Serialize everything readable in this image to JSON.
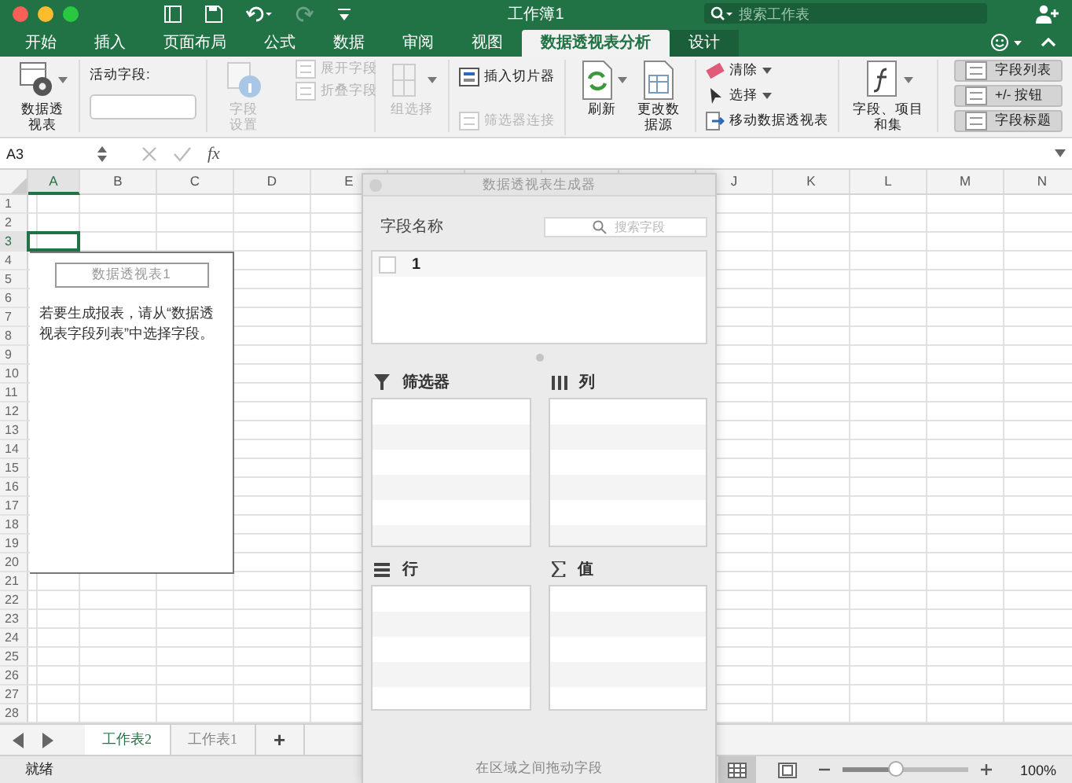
{
  "window": {
    "title": "工作簿1",
    "search_placeholder": "搜索工作表"
  },
  "tabs": [
    {
      "label": "开始",
      "selected": false,
      "contextual": false
    },
    {
      "label": "插入",
      "selected": false,
      "contextual": false
    },
    {
      "label": "页面布局",
      "selected": false,
      "contextual": false
    },
    {
      "label": "公式",
      "selected": false,
      "contextual": false
    },
    {
      "label": "数据",
      "selected": false,
      "contextual": false
    },
    {
      "label": "审阅",
      "selected": false,
      "contextual": false
    },
    {
      "label": "视图",
      "selected": false,
      "contextual": false
    },
    {
      "label": "数据透视表分析",
      "selected": true,
      "contextual": true
    },
    {
      "label": "设计",
      "selected": false,
      "contextual": true
    }
  ],
  "ribbon_groups": [
    {
      "items": [
        {
          "kind": "large",
          "label": "数据透视表",
          "disabled": false,
          "dropdown": true
        }
      ]
    },
    {
      "items": [
        {
          "kind": "field",
          "label": "活动字段:"
        }
      ]
    },
    {
      "items": [
        {
          "kind": "large",
          "label": "字段设置",
          "disabled": true,
          "dropdown": false
        },
        {
          "kind": "small",
          "label": "展开字段",
          "disabled": true,
          "dropdown": false
        },
        {
          "kind": "small",
          "label": "折叠字段",
          "disabled": true,
          "dropdown": false
        }
      ]
    },
    {
      "items": [
        {
          "kind": "large",
          "label": "组选择",
          "disabled": true,
          "dropdown": true
        }
      ]
    },
    {
      "items": [
        {
          "kind": "small",
          "label": "插入切片器",
          "disabled": false,
          "dropdown": false
        },
        {
          "kind": "small",
          "label": "筛选器连接",
          "disabled": true,
          "dropdown": false
        }
      ]
    },
    {
      "items": [
        {
          "kind": "large",
          "label": "刷新",
          "disabled": false,
          "dropdown": true
        },
        {
          "kind": "large",
          "label": "更改数据源",
          "disabled": false,
          "dropdown": false
        }
      ]
    },
    {
      "items": [
        {
          "kind": "small",
          "label": "清除",
          "disabled": false,
          "dropdown": true
        },
        {
          "kind": "small",
          "label": "选择",
          "disabled": false,
          "dropdown": true
        },
        {
          "kind": "small",
          "label": "移动数据透视表",
          "disabled": false,
          "dropdown": false
        }
      ]
    },
    {
      "items": [
        {
          "kind": "large",
          "label": "字段、项目和集",
          "disabled": false,
          "dropdown": true
        }
      ]
    },
    {
      "items": [
        {
          "kind": "toggle",
          "label": "字段列表",
          "selected": true
        },
        {
          "kind": "toggle",
          "label": "+/- 按钮",
          "selected": true
        },
        {
          "kind": "toggle",
          "label": "字段标题",
          "selected": true
        }
      ]
    }
  ],
  "formula_bar": {
    "name_box": "A3",
    "fx": "fx"
  },
  "sheet": {
    "columns_left": [
      {
        "label": "A",
        "selected": true
      },
      {
        "label": "B",
        "selected": false
      },
      {
        "label": "C",
        "selected": false
      },
      {
        "label": "D",
        "selected": false
      },
      {
        "label": "E",
        "selected": false
      }
    ],
    "columns_right": [
      {
        "label": "J",
        "selected": false
      },
      {
        "label": "K",
        "selected": false
      },
      {
        "label": "L",
        "selected": false
      },
      {
        "label": "M",
        "selected": false
      },
      {
        "label": "N",
        "selected": false
      }
    ],
    "rows": [
      {
        "label": "1",
        "selected": false
      },
      {
        "label": "2",
        "selected": false
      },
      {
        "label": "3",
        "selected": true
      },
      {
        "label": "4",
        "selected": false
      },
      {
        "label": "5",
        "selected": false
      },
      {
        "label": "6",
        "selected": false
      },
      {
        "label": "7",
        "selected": false
      },
      {
        "label": "8",
        "selected": false
      },
      {
        "label": "9",
        "selected": false
      },
      {
        "label": "10",
        "selected": false
      },
      {
        "label": "11",
        "selected": false
      },
      {
        "label": "12",
        "selected": false
      },
      {
        "label": "13",
        "selected": false
      },
      {
        "label": "14",
        "selected": false
      },
      {
        "label": "15",
        "selected": false
      },
      {
        "label": "16",
        "selected": false
      },
      {
        "label": "17",
        "selected": false
      },
      {
        "label": "18",
        "selected": false
      },
      {
        "label": "19",
        "selected": false
      },
      {
        "label": "20",
        "selected": false
      },
      {
        "label": "21",
        "selected": false
      },
      {
        "label": "22",
        "selected": false
      },
      {
        "label": "23",
        "selected": false
      },
      {
        "label": "24",
        "selected": false
      },
      {
        "label": "25",
        "selected": false
      },
      {
        "label": "26",
        "selected": false
      },
      {
        "label": "27",
        "selected": false
      },
      {
        "label": "28",
        "selected": false
      }
    ],
    "pivot_placeholder": {
      "title": "数据透视表1",
      "message": "若要生成报表，请从“数据透视表字段列表”中选择字段。"
    }
  },
  "pivot_builder": {
    "title": "数据透视表生成器",
    "fields_label": "字段名称",
    "search_placeholder": "搜索字段",
    "fields": [
      {
        "name": "1",
        "checked": false
      }
    ],
    "areas": [
      {
        "kind": "filter",
        "label": "筛选器"
      },
      {
        "kind": "columns",
        "label": "列"
      },
      {
        "kind": "rows",
        "label": "行"
      },
      {
        "kind": "values",
        "label": "值"
      }
    ],
    "hint": "在区域之间拖动字段"
  },
  "sheet_tabs": [
    {
      "label": "工作表2",
      "selected": true
    },
    {
      "label": "工作表1",
      "selected": false
    }
  ],
  "add_sheet": "+",
  "status_bar": {
    "status": "就绪",
    "view_buttons": [
      {
        "selected": true
      },
      {
        "selected": false
      }
    ],
    "zoom": {
      "level": 0.42,
      "reading": "100%"
    }
  }
}
